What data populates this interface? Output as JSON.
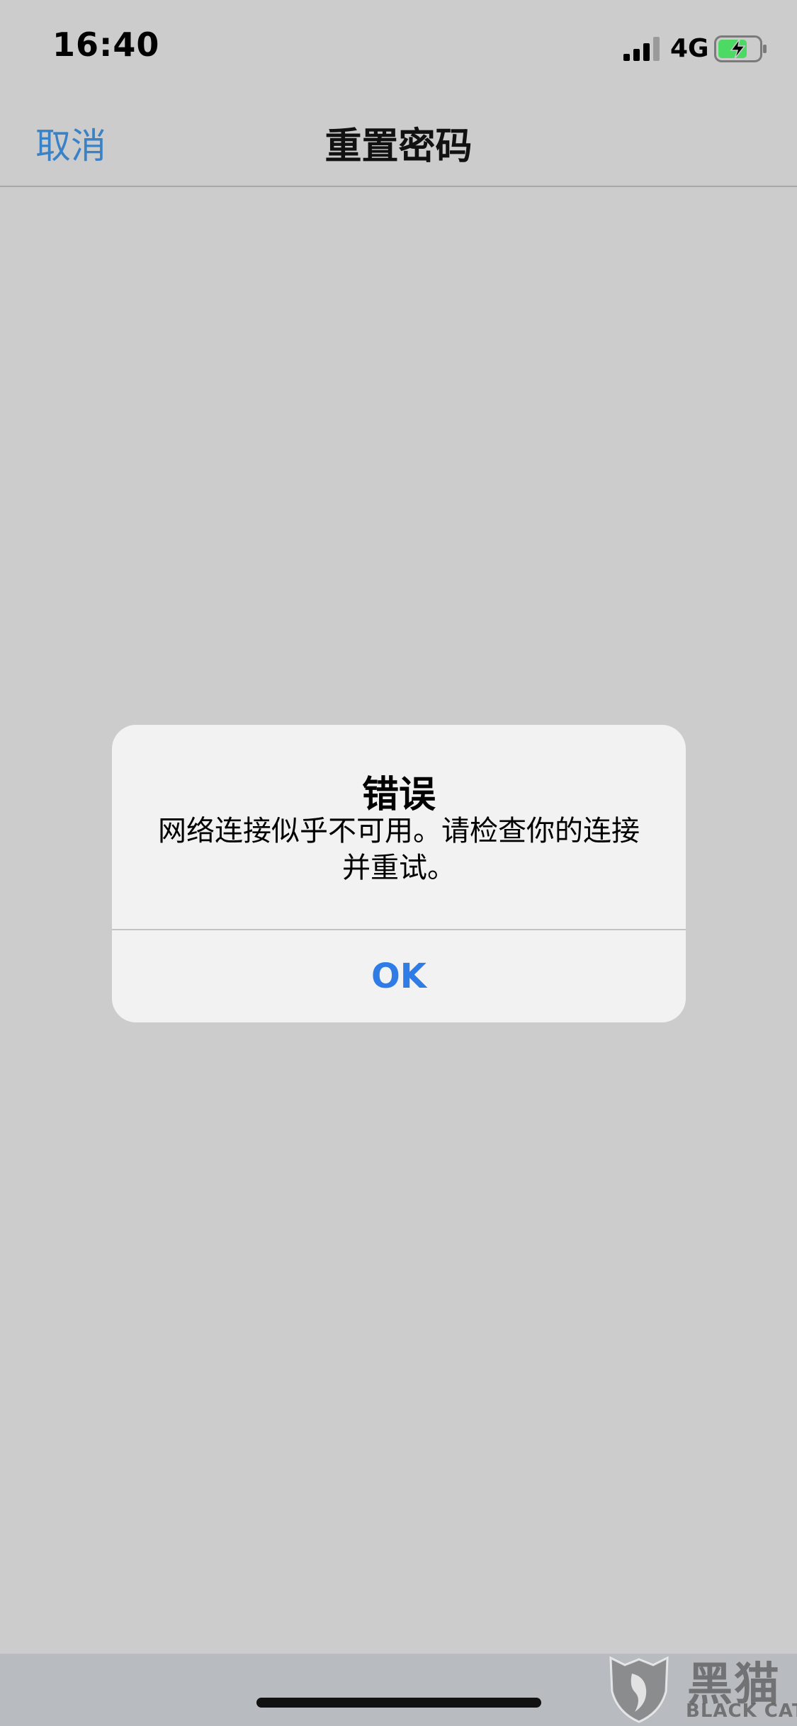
{
  "status_bar": {
    "time": "16:40",
    "network": "4G",
    "signal_icon": "cellular-signal-icon",
    "battery_icon": "battery-charging-icon",
    "battery_color": "#4cd964"
  },
  "nav": {
    "cancel_label": "取消",
    "title": "重置密码",
    "accent_color": "#3a82c7"
  },
  "alert": {
    "title": "错误",
    "message": "网络连接似乎不可用。请检查你的连接并重试。",
    "ok_label": "OK",
    "button_color": "#2f7ce6"
  },
  "watermark": {
    "logo_icon": "black-cat-shield-icon",
    "text_cn": "黑猫",
    "text_en": "BLACK CAT"
  }
}
